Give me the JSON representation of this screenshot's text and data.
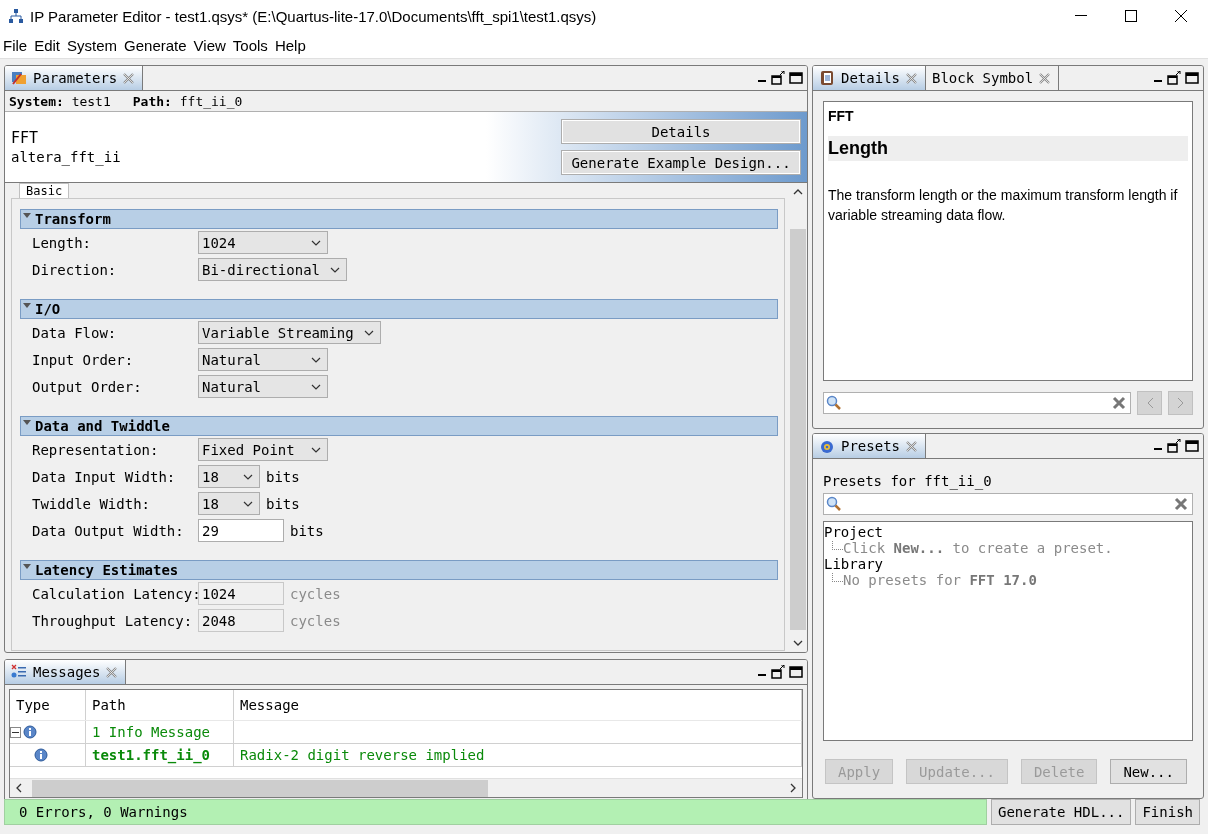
{
  "window": {
    "title": "IP Parameter Editor - test1.qsys* (E:\\Quartus-lite-17.0\\Documents\\fft_spi1\\test1.qsys)"
  },
  "menu": [
    "File",
    "Edit",
    "System",
    "Generate",
    "View",
    "Tools",
    "Help"
  ],
  "parameters_panel": {
    "tab": "Parameters",
    "system_label": "System:",
    "system": "test1",
    "path_label": "Path:",
    "path": "fft_ii_0",
    "component": "FFT",
    "component_id": "altera_fft_ii",
    "buttons": [
      "Details",
      "Generate Example Design..."
    ],
    "page_tab": "Basic",
    "sections": [
      {
        "title": "Transform",
        "expanded": true,
        "rows": [
          {
            "kind": "dropdown",
            "label": "Length:",
            "value": "1024"
          },
          {
            "kind": "dropdown",
            "label": "Direction:",
            "value": "Bi-directional"
          }
        ]
      },
      {
        "title": "I/O",
        "expanded": true,
        "rows": [
          {
            "kind": "dropdown",
            "label": "Data Flow:",
            "value": "Variable Streaming"
          },
          {
            "kind": "dropdown",
            "label": "Input Order:",
            "value": "Natural"
          },
          {
            "kind": "dropdown",
            "label": "Output Order:",
            "value": "Natural"
          }
        ]
      },
      {
        "title": "Data and Twiddle",
        "expanded": true,
        "rows": [
          {
            "kind": "dropdown",
            "label": "Representation:",
            "value": "Fixed Point"
          },
          {
            "kind": "dropdown",
            "label": "Data Input Width:",
            "value": "18",
            "unit": "bits"
          },
          {
            "kind": "dropdown",
            "label": "Twiddle Width:",
            "value": "18",
            "unit": "bits"
          },
          {
            "kind": "input",
            "label": "Data Output Width:",
            "value": "29",
            "unit": "bits"
          }
        ]
      },
      {
        "title": "Latency Estimates",
        "expanded": true,
        "rows": [
          {
            "kind": "readonly",
            "label": "Calculation Latency:",
            "value": "1024",
            "unit": "cycles"
          },
          {
            "kind": "readonly",
            "label": "Throughput Latency:",
            "value": "2048",
            "unit": "cycles"
          }
        ]
      }
    ]
  },
  "messages_panel": {
    "tab": "Messages",
    "columns": [
      "Type",
      "Path",
      "Message"
    ],
    "rows": [
      {
        "path": "1 Info Message",
        "expanded": true,
        "children": [
          {
            "path": "test1.fft_ii_0",
            "message": "Radix-2 digit reverse implied"
          }
        ]
      }
    ]
  },
  "details_panel": {
    "tabs": [
      {
        "label": "Details",
        "selected": true
      },
      {
        "label": "Block Symbol",
        "selected": false
      }
    ],
    "title": "FFT",
    "heading": "Length",
    "text": "The transform length or the maximum transform length if variable streaming data flow."
  },
  "presets_panel": {
    "tab": "Presets",
    "label": "Presets for fft_ii_0",
    "tree": [
      {
        "label": "Project",
        "children": [
          {
            "label": "Click **New...** to create a preset."
          }
        ]
      },
      {
        "label": "Library",
        "children": [
          {
            "label": "No presets for **FFT 17.0**"
          }
        ]
      }
    ],
    "buttons": [
      {
        "label": "Apply",
        "disabled": true
      },
      {
        "label": "Update...",
        "disabled": true
      },
      {
        "label": "Delete",
        "disabled": true
      },
      {
        "label": "New...",
        "disabled": false
      }
    ]
  },
  "status_bar": {
    "text": "0 Errors, 0 Warnings",
    "buttons": [
      "Generate HDL...",
      "Finish"
    ]
  }
}
